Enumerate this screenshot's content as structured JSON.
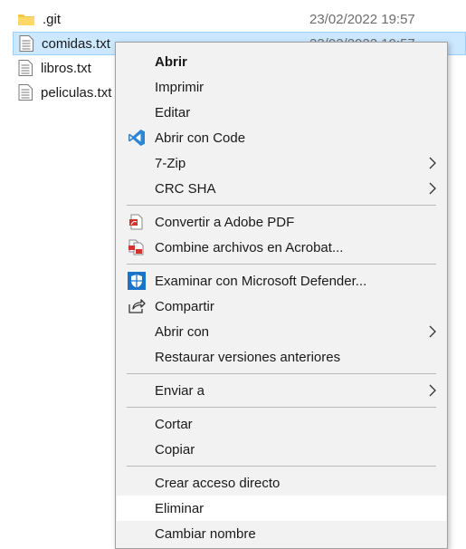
{
  "files": [
    {
      "name": ".git",
      "date": "23/02/2022 19:57",
      "type": "folder"
    },
    {
      "name": "comidas.txt",
      "date": "23/02/2022 19:57",
      "type": "text"
    },
    {
      "name": "libros.txt",
      "date": "",
      "type": "text"
    },
    {
      "name": "peliculas.txt",
      "date": "",
      "type": "text"
    }
  ],
  "menu": {
    "items": [
      {
        "label": "Abrir",
        "icon": "",
        "submenu": false
      },
      {
        "label": "Imprimir",
        "icon": "",
        "submenu": false
      },
      {
        "label": "Editar",
        "icon": "",
        "submenu": false
      },
      {
        "label": "Abrir con Code",
        "icon": "vscode-icon",
        "submenu": false
      },
      {
        "label": "7-Zip",
        "icon": "",
        "submenu": true
      },
      {
        "label": "CRC SHA",
        "icon": "",
        "submenu": true
      },
      {
        "label": "Convertir a Adobe PDF",
        "icon": "adobe-pdf-icon",
        "submenu": false
      },
      {
        "label": "Combine archivos en Acrobat...",
        "icon": "acrobat-combine-icon",
        "submenu": false
      },
      {
        "label": "Examinar con Microsoft Defender...",
        "icon": "defender-shield-icon",
        "submenu": false
      },
      {
        "label": "Compartir",
        "icon": "share-icon",
        "submenu": false
      },
      {
        "label": "Abrir con",
        "icon": "",
        "submenu": true
      },
      {
        "label": "Restaurar versiones anteriores",
        "icon": "",
        "submenu": false
      },
      {
        "label": "Enviar a",
        "icon": "",
        "submenu": true
      },
      {
        "label": "Cortar",
        "icon": "",
        "submenu": false
      },
      {
        "label": "Copiar",
        "icon": "",
        "submenu": false
      },
      {
        "label": "Crear acceso directo",
        "icon": "",
        "submenu": false
      },
      {
        "label": "Eliminar",
        "icon": "",
        "submenu": false
      },
      {
        "label": "Cambiar nombre",
        "icon": "",
        "submenu": false
      }
    ]
  },
  "colors": {
    "selection_bg": "#cce8ff",
    "selection_border": "#99d1ff",
    "menu_bg": "#f2f2f2",
    "vscode_blue": "#2a87d6",
    "defender_blue": "#1a73c9",
    "pdf_red": "#d1322a"
  }
}
